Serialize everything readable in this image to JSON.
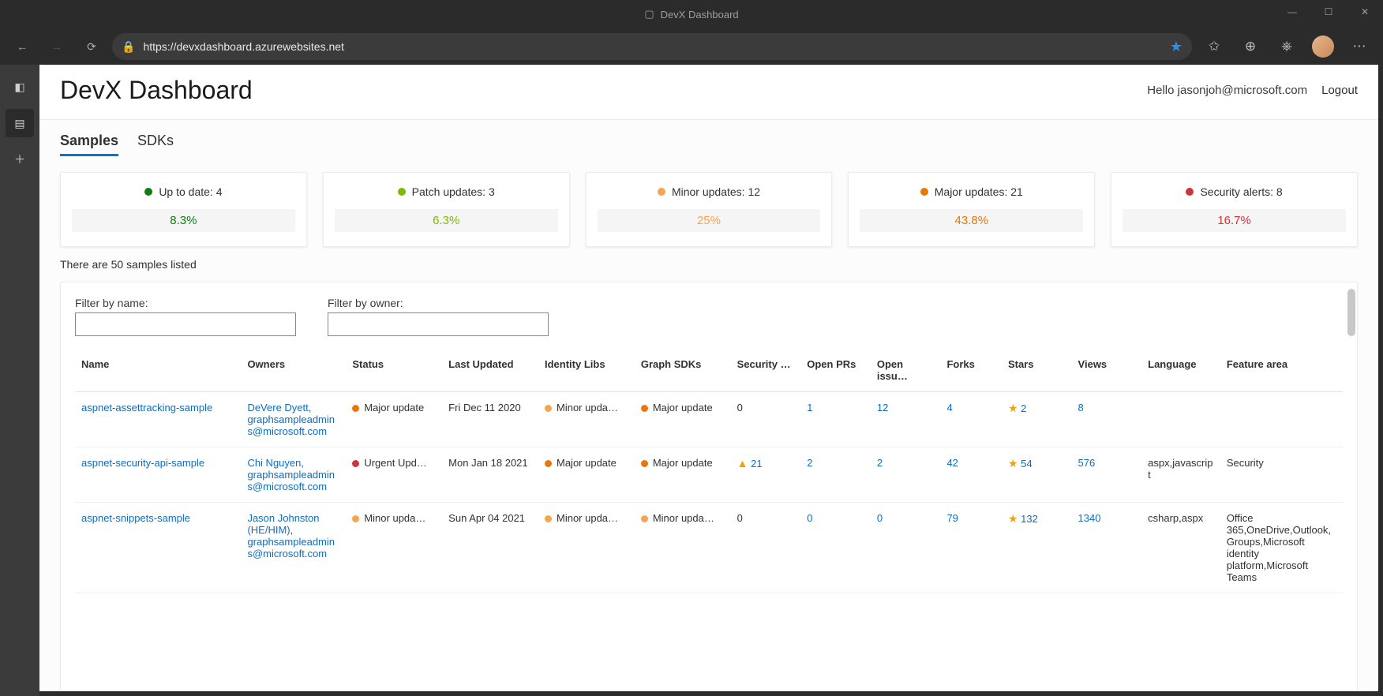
{
  "browser": {
    "tab_title": "DevX Dashboard",
    "url": "https://devxdashboard.azurewebsites.net"
  },
  "header": {
    "title": "DevX Dashboard",
    "greeting": "Hello jasonjoh@microsoft.com",
    "logout": "Logout"
  },
  "tabs": {
    "samples": "Samples",
    "sdks": "SDKs"
  },
  "cards": [
    {
      "label": "Up to date: 4",
      "pct": "8.3%",
      "dot": "#107c10",
      "pct_color": "#107c10"
    },
    {
      "label": "Patch updates: 3",
      "pct": "6.3%",
      "dot": "#7fba00",
      "pct_color": "#7fba00"
    },
    {
      "label": "Minor updates: 12",
      "pct": "25%",
      "dot": "#f7a450",
      "pct_color": "#f7a450"
    },
    {
      "label": "Major updates: 21",
      "pct": "43.8%",
      "dot": "#e8780c",
      "pct_color": "#e8780c"
    },
    {
      "label": "Security alerts: 8",
      "pct": "16.7%",
      "dot": "#d13438",
      "pct_color": "#d13438"
    }
  ],
  "samples_count": "There are 50 samples listed",
  "filters": {
    "name_label": "Filter by name:",
    "owner_label": "Filter by owner:",
    "name_value": "",
    "owner_value": ""
  },
  "columns": {
    "name": "Name",
    "owners": "Owners",
    "status": "Status",
    "last_updated": "Last Updated",
    "identity": "Identity Libs",
    "graph": "Graph SDKs",
    "security": "Security …",
    "prs": "Open PRs",
    "issues": "Open issu…",
    "forks": "Forks",
    "stars": "Stars",
    "views": "Views",
    "language": "Language",
    "feature": "Feature area"
  },
  "rows": [
    {
      "name": "aspnet-assettracking-sample",
      "owners": "DeVere Dyett, graphsampleadmins@microsoft.com",
      "status": {
        "dot": "#e8780c",
        "text": "Major update"
      },
      "last_updated": "Fri Dec 11 2020",
      "identity": {
        "dot": "#f7a450",
        "text": "Minor upda…"
      },
      "graph": {
        "dot": "#e8780c",
        "text": "Major update"
      },
      "security": {
        "warn": false,
        "text": "0",
        "link": false
      },
      "prs": "1",
      "issues": "12",
      "forks": "4",
      "stars": "2",
      "views": "8",
      "language": "",
      "feature": ""
    },
    {
      "name": "aspnet-security-api-sample",
      "owners": "Chi Nguyen, graphsampleadmins@microsoft.com",
      "status": {
        "dot": "#d13438",
        "text": "Urgent Upd…"
      },
      "last_updated": "Mon Jan 18 2021",
      "identity": {
        "dot": "#e8780c",
        "text": "Major update"
      },
      "graph": {
        "dot": "#e8780c",
        "text": "Major update"
      },
      "security": {
        "warn": true,
        "text": "21",
        "link": true
      },
      "prs": "2",
      "issues": "2",
      "forks": "42",
      "stars": "54",
      "views": "576",
      "language": "aspx,javascript",
      "feature": "Security"
    },
    {
      "name": "aspnet-snippets-sample",
      "owners": "Jason Johnston (HE/HIM), graphsampleadmins@microsoft.com",
      "status": {
        "dot": "#f7a450",
        "text": "Minor upda…"
      },
      "last_updated": "Sun Apr 04 2021",
      "identity": {
        "dot": "#f7a450",
        "text": "Minor upda…"
      },
      "graph": {
        "dot": "#f7a450",
        "text": "Minor upda…"
      },
      "security": {
        "warn": false,
        "text": "0",
        "link": false
      },
      "prs": "0",
      "issues": "0",
      "forks": "79",
      "stars": "132",
      "views": "1340",
      "language": "csharp,aspx",
      "feature": "Office 365,OneDrive,Outlook,Groups,Microsoft identity platform,Microsoft Teams"
    }
  ],
  "colors": {
    "link": "#0F6CBD"
  }
}
